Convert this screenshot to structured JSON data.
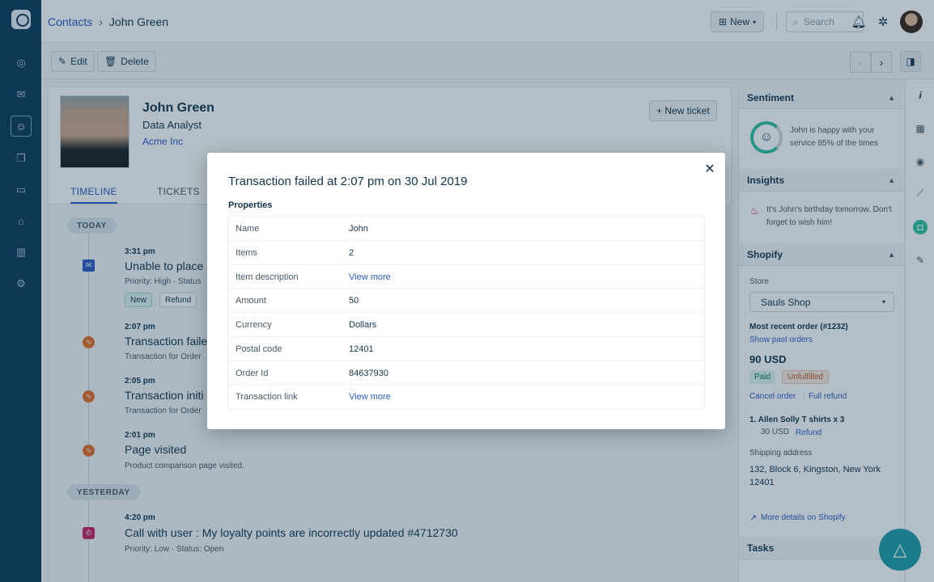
{
  "breadcrumb": {
    "parent": "Contacts",
    "current": "John Green"
  },
  "topbar": {
    "new_label": "New",
    "search_placeholder": "Search"
  },
  "actions": {
    "edit": "Edit",
    "delete": "Delete"
  },
  "contact": {
    "name": "John Green",
    "title": "Data Analyst",
    "company": "Acme Inc",
    "new_ticket": "+ New ticket"
  },
  "tabs": [
    {
      "label": "TIMELINE"
    },
    {
      "label": "TICKETS"
    }
  ],
  "timeline": {
    "today": "TODAY",
    "yesterday": "YESTERDAY",
    "items": [
      {
        "time": "3:31 pm",
        "title": "Unable to place a",
        "meta": "Priority: High  ·  Status",
        "tags": [
          "New",
          "Refund"
        ],
        "icon": "mail-icon"
      },
      {
        "time": "2:07 pm",
        "title": "Transaction faile",
        "meta": "Transaction for Order",
        "icon": "activity-icon"
      },
      {
        "time": "2:05 pm",
        "title": "Transaction initi",
        "meta": "Transaction for Order",
        "icon": "activity-icon"
      },
      {
        "time": "2:01 pm",
        "title": "Page visited",
        "meta": "Product comparison page visited.",
        "icon": "activity-icon"
      },
      {
        "time": "4:20 pm",
        "title": "Call with user : My loyalty points are incorrectly updated #4712730",
        "meta": "Priority: Low  ·  Status: Open",
        "icon": "phone-icon"
      }
    ]
  },
  "sidebar": {
    "sentiment": {
      "title": "Sentiment",
      "text": "John is happy with your service 85% of the times"
    },
    "insights": {
      "title": "Insights",
      "text": "It's John's birthday tomorrow. Don't forget to wish him!"
    },
    "shopify": {
      "title": "Shopify",
      "store_label": "Store",
      "store_value": "Sauls Shop",
      "recent_order": "Most recent order (#1232)",
      "show_past": "Show past orders",
      "amount": "90 USD",
      "paid": "Paid",
      "unfulfilled": "Unfulfilled",
      "cancel_order": "Cancel order",
      "full_refund": "Full refund",
      "item": "1. Allen Solly T shirts x 3",
      "item_price": "30 USD",
      "item_refund": "Refund",
      "shipping_label": "Shipping address",
      "shipping_address": "132, Block 6, Kingston, New York 12401",
      "more_details": "More details on Shopify"
    },
    "tasks": {
      "title": "Tasks"
    }
  },
  "modal": {
    "title": "Transaction failed at 2:07 pm on 30 Jul 2019",
    "properties_label": "Properties",
    "rows": [
      {
        "key": "Name",
        "value": "John"
      },
      {
        "key": "Items",
        "value": "2"
      },
      {
        "key": "Item description",
        "value": "View more"
      },
      {
        "key": "Amount",
        "value": "50"
      },
      {
        "key": "Currency",
        "value": "Dollars"
      },
      {
        "key": "Postal code",
        "value": "12401"
      },
      {
        "key": "Order Id",
        "value": "84637930"
      },
      {
        "key": "Transaction link",
        "value": "View more"
      }
    ]
  }
}
